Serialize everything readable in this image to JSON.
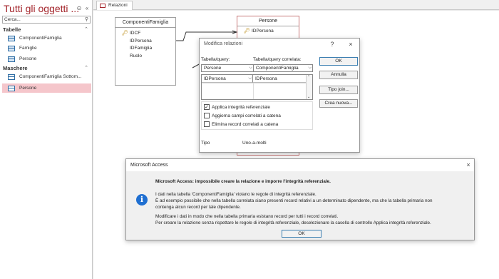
{
  "nav": {
    "title": "Tutti gli oggetti ...",
    "search_placeholder": "Cerca...",
    "groups": [
      {
        "label": "Tabelle",
        "items": [
          "ComponentiFamiglia",
          "Famiglie",
          "Persone"
        ]
      },
      {
        "label": "Maschere",
        "items": [
          "ComponentiFamiglia Sottom...",
          "Persone"
        ]
      }
    ],
    "selected_item": "Persone"
  },
  "tab": {
    "label": "Relazioni"
  },
  "tables": {
    "componenti": {
      "title": "ComponentiFamiglia",
      "fields": [
        "IDCF",
        "IDPersona",
        "IDFamiglia",
        "Ruolo"
      ],
      "key_field": "IDCF"
    },
    "persone": {
      "title": "Persone",
      "fields": [
        "IDPersona"
      ],
      "key_field": "IDPersona"
    }
  },
  "edit_dialog": {
    "title": "Modifica relazioni",
    "help": "?",
    "close": "×",
    "table_label": "Tabella/query:",
    "related_label": "Tabella/query correlata:",
    "table_value": "Persone",
    "related_value": "ComponentiFamiglia",
    "field_left": "IDPersona",
    "field_right": "IDPersona",
    "buttons": {
      "ok": "OK",
      "cancel": "Annulla",
      "join": "Tipo join...",
      "new": "Crea nuova..."
    },
    "checks": [
      {
        "label": "Applica integrità referenziale",
        "checked": true
      },
      {
        "label": "Aggiorna campi correlati a catena",
        "checked": false
      },
      {
        "label": "Elimina record correlati a catena",
        "checked": false
      }
    ],
    "type_label": "Tipo",
    "type_value": "Uno-a-molti"
  },
  "message": {
    "title": "Microsoft Access",
    "close": "×",
    "heading": "Microsoft Access: impossibile creare la relazione e imporre l'integrità referenziale.",
    "lines": [
      "I dati nella tabella 'ComponentiFamiglia' violano le regole di integrità referenziale.",
      "È ad esempio possibile che nella tabella correlata siano presenti record relativi a un determinato dipendente, ma che la tabella primaria non",
      "contenga alcun record per tale dipendente.",
      "Modificare i dati in modo che nella tabella primaria esistano record per tutti i record correlati.",
      "Per creare la relazione senza rispettare le regole di integrità referenziale, deselezionare la casella di controllo Applica integrità referenziale."
    ],
    "ok": "OK"
  }
}
